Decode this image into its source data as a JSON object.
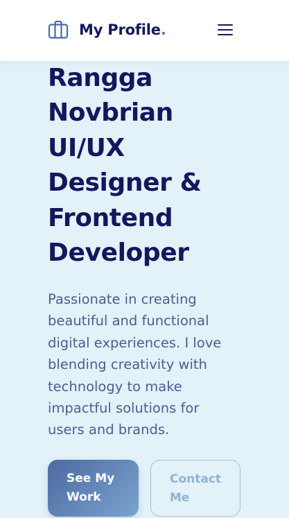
{
  "navbar": {
    "brand_icon": "briefcase-icon",
    "brand_name": "My Profile",
    "brand_dot": ".",
    "menu_icon": "hamburger-menu-icon"
  },
  "hero": {
    "title_lines": [
      "Rangga",
      "Novbrian",
      "UI/UX",
      "Designer &",
      "Frontend",
      "Developer"
    ],
    "description_lines": [
      "Passionate in creating",
      "beautiful and functional",
      "digital experiences. I love",
      "blending creativity with",
      "technology to make",
      "impactful solutions for",
      "users and brands."
    ]
  },
  "actions": {
    "primary_lines": [
      "See My",
      "Work"
    ],
    "secondary_lines": [
      "Contact",
      "Me"
    ]
  },
  "colors": {
    "background": "#e3f1f8",
    "navbar": "#ffffff",
    "heading": "#15175c",
    "body_text": "#4a5f8f",
    "accent": "#5b7fb0",
    "primary_gradient_start": "#4d6aa1",
    "primary_gradient_end": "#7aa3cf",
    "secondary_border": "#9ec0de"
  }
}
